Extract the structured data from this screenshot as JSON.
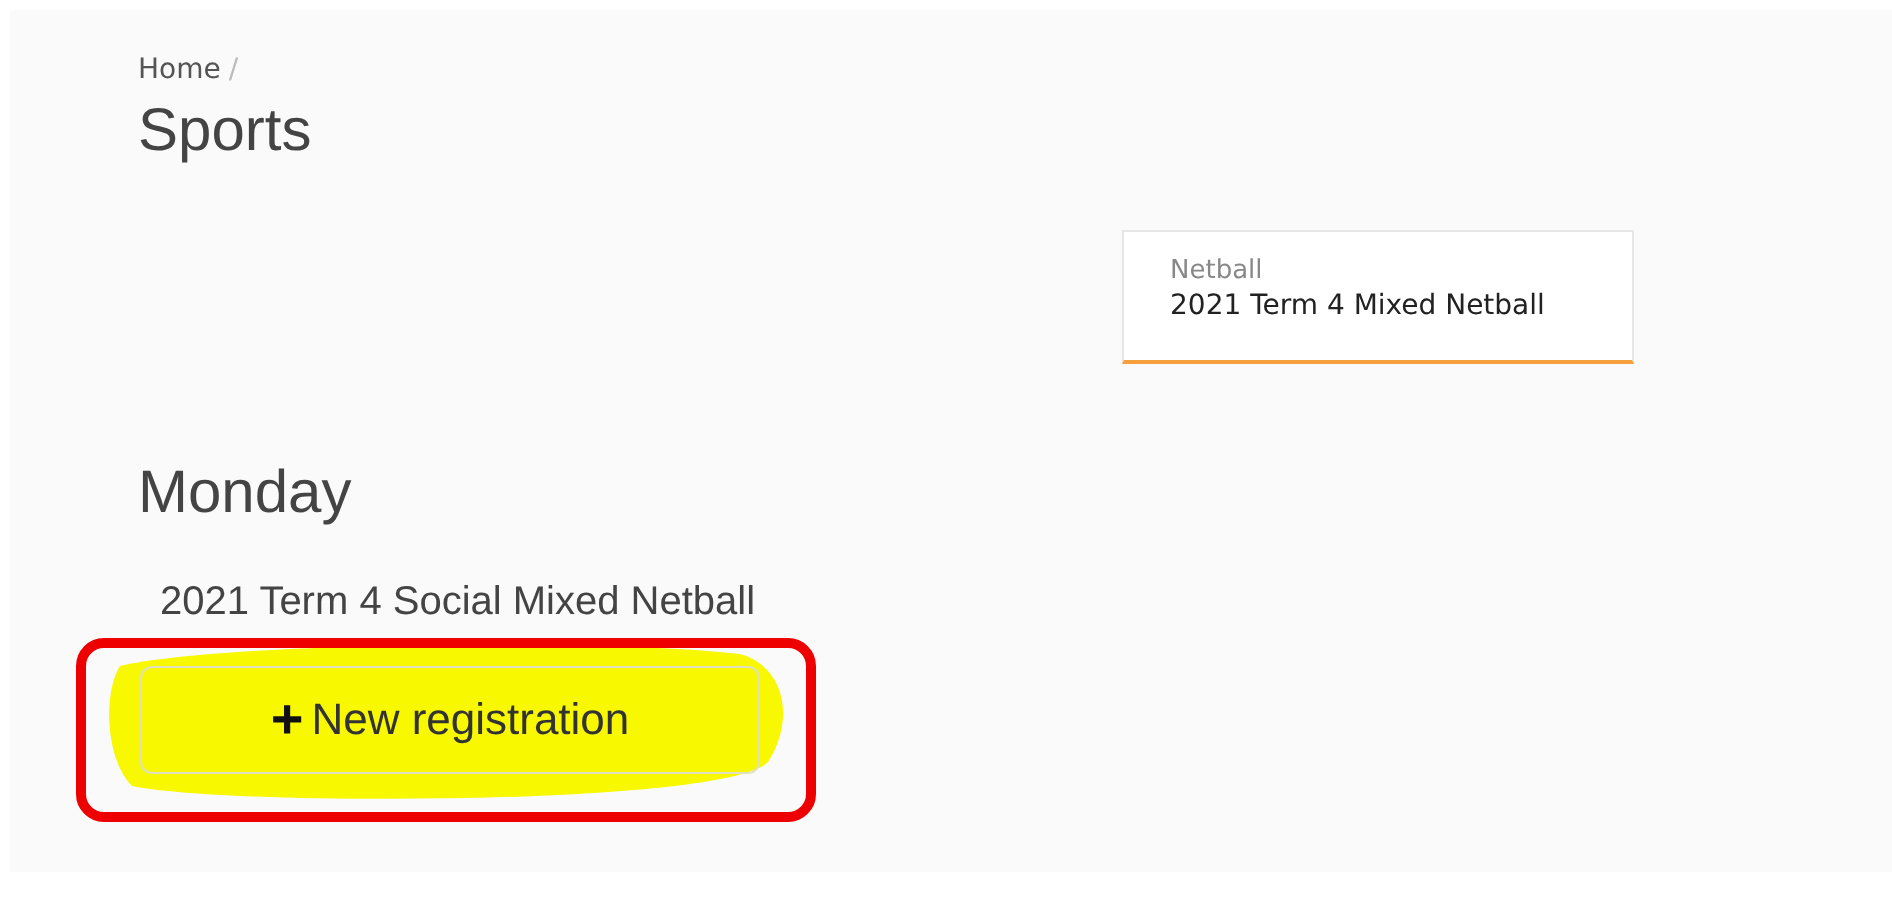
{
  "breadcrumb": [
    {
      "label": "Home"
    }
  ],
  "breadcrumb_separator": "/",
  "title": "Sports",
  "competitions": [
    {
      "sport": "Netball",
      "name": "2021 Term 4 Mixed Netball",
      "selected": true
    }
  ],
  "day": "Monday",
  "league": "2021 Term 4 Social Mixed Netball",
  "new_button": {
    "icon": "+",
    "label": "New registration"
  }
}
